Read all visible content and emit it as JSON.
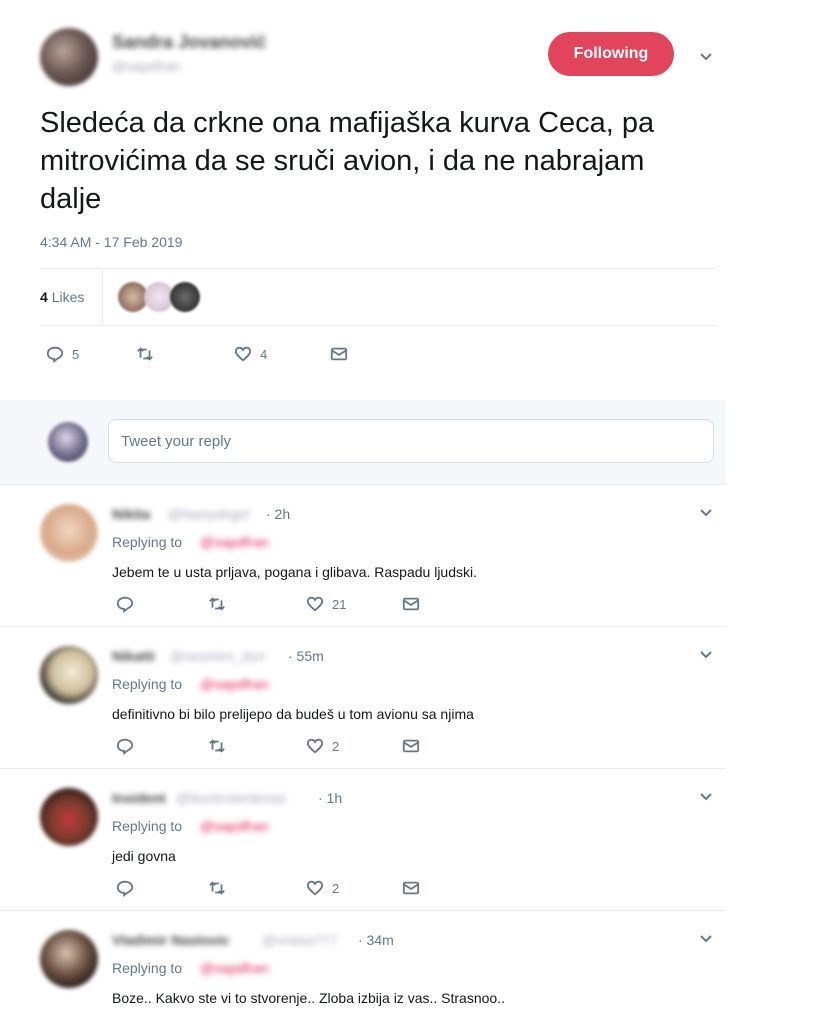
{
  "tweet": {
    "author_name": "Sandra Jovanović",
    "author_handle": "@sapdfran",
    "follow_label": "Following",
    "text": "Sledeća da crkne ona mafijaška kurva Ceca, pa mitrovićima da se sruči avion, i da ne nabrajam dalje",
    "timestamp": "4:34 AM - 17 Feb 2019",
    "likes_count": "4",
    "likes_label": "Likes",
    "replies_count": "5",
    "retweets_count": "",
    "like_count_action": "4"
  },
  "composer": {
    "placeholder": "Tweet your reply"
  },
  "replies": [
    {
      "name": "Nikita",
      "handle": "@Nanyahgirl",
      "time": "· 2h",
      "replying_label": "Replying to",
      "replying_to": "@sapdfran",
      "text": "Jebem te u usta prljava, pogana i glibava. Raspadu ljudski.",
      "replies": "",
      "retweets": "",
      "likes": "21"
    },
    {
      "name": "Nikatti",
      "handle": "@nesmirn_dun",
      "time": "· 55m",
      "replying_label": "Replying to",
      "replying_to": "@sapdfran",
      "text": "definitivno bi bilo prelijepo da budeš u tom avionu sa njima",
      "replies": "",
      "retweets": "",
      "likes": "2"
    },
    {
      "name": "Insident",
      "handle": "@ikontrolerdenas",
      "time": "· 1h",
      "replying_label": "Replying to",
      "replying_to": "@sapdfran",
      "text": "jedi govna",
      "replies": "",
      "retweets": "",
      "likes": "2"
    },
    {
      "name": "Vladimir Nastovic",
      "handle": "@vnasa777",
      "time": "· 34m",
      "replying_label": "Replying to",
      "replying_to": "@sapdfran",
      "text": "Boze.. Kakvo ste vi to stvorenje.. Zloba izbija iz vas.. Strasnoo.."
    }
  ],
  "icons": {
    "reply": "reply-icon",
    "retweet": "retweet-icon",
    "like": "heart-icon",
    "dm": "envelope-icon",
    "more": "chevron-down-icon"
  },
  "colors": {
    "follow_button": "#e2445c",
    "secondary_text": "#657786",
    "composer_bg": "#f5f8fa"
  }
}
